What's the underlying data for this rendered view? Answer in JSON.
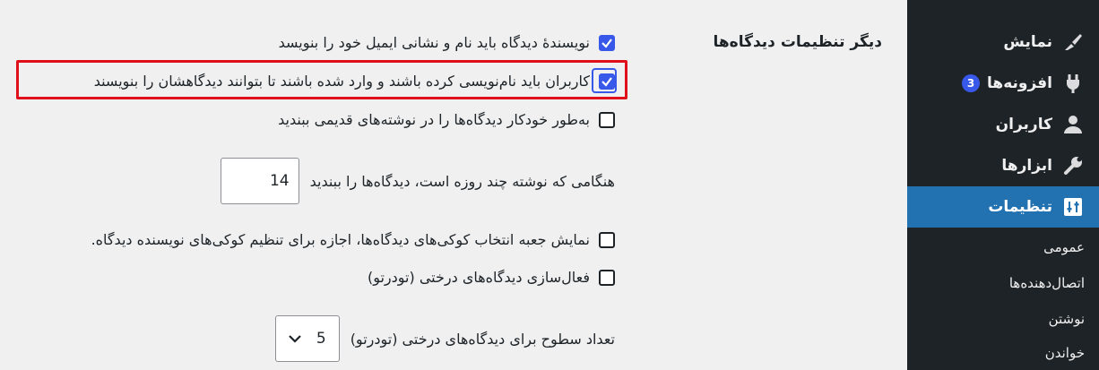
{
  "sidebar": {
    "items": [
      {
        "label": "نمایش",
        "icon": "brush-icon"
      },
      {
        "label": "افزونه‌ها",
        "icon": "plugin-icon",
        "badge": "3"
      },
      {
        "label": "کاربران",
        "icon": "user-icon"
      },
      {
        "label": "ابزارها",
        "icon": "wrench-icon"
      },
      {
        "label": "تنظیمات",
        "icon": "settings-icon",
        "active": true
      }
    ],
    "submenu": [
      "عمومی",
      "اتصال‌دهنده‌ها",
      "نوشتن",
      "خواندن"
    ]
  },
  "section": {
    "title": "دیگر تنظیمات دیدگاه‌ها",
    "options": [
      {
        "label": "نویسندهٔ دیدگاه باید نام و نشانی ایمیل خود را بنویسد",
        "checked": true
      },
      {
        "label": "کاربران باید نام‌نویسی کرده باشند و وارد شده باشند تا بتوانند دیدگاهشان را بنویسند",
        "checked": true,
        "highlighted": true
      },
      {
        "label": "به‌طور خودکار دیدگاه‌ها را در نوشته‌های قدیمی ببندید",
        "checked": false
      },
      {
        "label": "نمایش جعبه انتخاب کوکی‌های دیدگاه‌ها، اجازه برای تنظیم کوکی‌های نویسنده دیدگاه.",
        "checked": false
      },
      {
        "label": "فعال‌سازی دیدگاه‌های درختی (تودرتو)",
        "checked": false
      }
    ],
    "close_after": {
      "label": "هنگامی که نوشته چند روزه است، دیدگاه‌ها را ببندید",
      "value": "14"
    },
    "thread_depth": {
      "label": "تعداد سطوح برای دیدگاه‌های درختی (تودرتو)",
      "value": "5"
    }
  },
  "colors": {
    "accent": "#2271b1",
    "highlight_border": "#e0101a",
    "checkbox": "#3858e9"
  }
}
